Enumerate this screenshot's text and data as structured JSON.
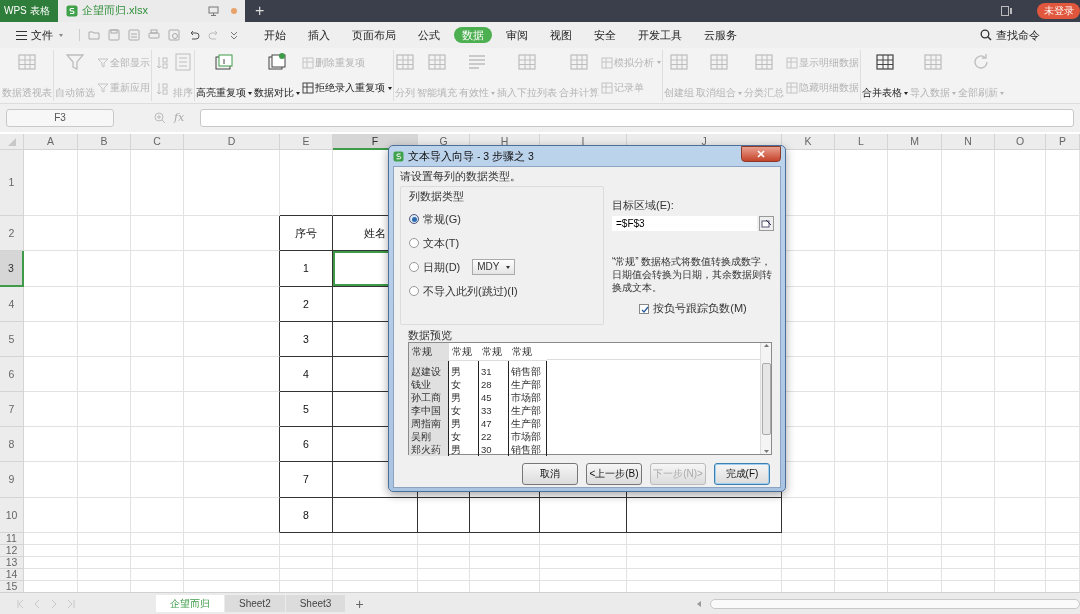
{
  "title_bar": {
    "app_tab": "WPS 表格",
    "file_tab": {
      "label": "企望而归.xlsx",
      "unsaved": true
    },
    "new_tab": "+",
    "account_badge": "未登录"
  },
  "menu_bar": {
    "file_menu": "文件",
    "tabs": [
      {
        "label": "开始",
        "selected": false
      },
      {
        "label": "插入",
        "selected": false
      },
      {
        "label": "页面布局",
        "selected": false
      },
      {
        "label": "公式",
        "selected": false
      },
      {
        "label": "数据",
        "selected": true
      },
      {
        "label": "审阅",
        "selected": false
      },
      {
        "label": "视图",
        "selected": false
      },
      {
        "label": "安全",
        "selected": false
      },
      {
        "label": "开发工具",
        "selected": false
      },
      {
        "label": "云服务",
        "selected": false
      }
    ],
    "search": "查找命令"
  },
  "ribbon": {
    "groups": [
      {
        "items": [
          {
            "kind": "large",
            "label": "数据透视表",
            "disabled": true,
            "dropdown": false
          }
        ]
      },
      {
        "items": [
          {
            "kind": "large",
            "label": "自动筛选",
            "disabled": true,
            "dropdown": false
          },
          {
            "kind": "stack",
            "items": [
              {
                "label": "全部显示",
                "disabled": true,
                "dropdown": false
              },
              {
                "label": "重新应用",
                "disabled": true,
                "dropdown": false
              }
            ]
          }
        ]
      },
      {
        "items": [
          {
            "kind": "icon-stack",
            "items": [
              {
                "disabled": true
              },
              {
                "disabled": true
              }
            ]
          },
          {
            "kind": "large",
            "label": "排序",
            "disabled": true,
            "dropdown": false
          }
        ]
      },
      {
        "items": [
          {
            "kind": "large",
            "label": "高亮重复项",
            "disabled": false,
            "dropdown": true
          },
          {
            "kind": "large",
            "label": "数据对比",
            "disabled": false,
            "dropdown": true
          },
          {
            "kind": "stack",
            "items": [
              {
                "label": "删除重复项",
                "disabled": true,
                "dropdown": false
              },
              {
                "label": "拒绝录入重复项",
                "disabled": false,
                "dropdown": true
              }
            ]
          }
        ]
      },
      {
        "items": [
          {
            "kind": "large",
            "label": "分列",
            "disabled": true,
            "dropdown": false
          },
          {
            "kind": "large",
            "label": "智能填充",
            "disabled": true,
            "dropdown": false
          },
          {
            "kind": "large",
            "label": "有效性",
            "disabled": true,
            "dropdown": true
          },
          {
            "kind": "large",
            "label": "插入下拉列表",
            "disabled": true,
            "dropdown": false
          },
          {
            "kind": "large",
            "label": "合并计算",
            "disabled": true,
            "dropdown": false
          },
          {
            "kind": "stack",
            "items": [
              {
                "label": "模拟分析",
                "disabled": true,
                "dropdown": true
              },
              {
                "label": "记录单",
                "disabled": true,
                "dropdown": false
              }
            ]
          }
        ]
      },
      {
        "items": [
          {
            "kind": "large",
            "label": "创建组",
            "disabled": true,
            "dropdown": false
          },
          {
            "kind": "large",
            "label": "取消组合",
            "disabled": true,
            "dropdown": true
          },
          {
            "kind": "large",
            "label": "分类汇总",
            "disabled": true,
            "dropdown": false
          },
          {
            "kind": "stack",
            "items": [
              {
                "label": "显示明细数据",
                "disabled": true,
                "dropdown": false
              },
              {
                "label": "隐藏明细数据",
                "disabled": true,
                "dropdown": false
              }
            ]
          }
        ]
      },
      {
        "items": [
          {
            "kind": "large",
            "label": "合并表格",
            "disabled": false,
            "dropdown": true
          },
          {
            "kind": "large",
            "label": "导入数据",
            "disabled": true,
            "dropdown": true
          },
          {
            "kind": "large",
            "label": "全部刷新",
            "disabled": true,
            "dropdown": true
          }
        ]
      }
    ]
  },
  "formula_bar": {
    "name_box": "F3",
    "function_label": "fx"
  },
  "sheet": {
    "columns": [
      {
        "label": "A",
        "selected": false
      },
      {
        "label": "B",
        "selected": false
      },
      {
        "label": "C",
        "selected": false
      },
      {
        "label": "D",
        "selected": false
      },
      {
        "label": "E",
        "selected": false
      },
      {
        "label": "F",
        "selected": true
      },
      {
        "label": "G",
        "selected": false
      },
      {
        "label": "H",
        "selected": false
      },
      {
        "label": "I",
        "selected": false
      },
      {
        "label": "J",
        "selected": false
      },
      {
        "label": "K",
        "selected": false
      },
      {
        "label": "L",
        "selected": false
      },
      {
        "label": "M",
        "selected": false
      },
      {
        "label": "N",
        "selected": false
      },
      {
        "label": "O",
        "selected": false
      },
      {
        "label": "P",
        "selected": false
      }
    ],
    "rows": [
      {
        "label": "1",
        "selected": false,
        "cells": []
      },
      {
        "label": "2",
        "selected": false,
        "cells": [
          {
            "text": "",
            "selected": false
          },
          {
            "text": "",
            "selected": false
          },
          {
            "text": "",
            "selected": false
          },
          {
            "text": "",
            "selected": false
          },
          {
            "text": "序号",
            "selected": false
          },
          {
            "text": "姓名",
            "selected": false
          }
        ]
      },
      {
        "label": "3",
        "selected": true,
        "cells": [
          {
            "text": "",
            "selected": false
          },
          {
            "text": "",
            "selected": false
          },
          {
            "text": "",
            "selected": false
          },
          {
            "text": "",
            "selected": false
          },
          {
            "text": "1",
            "selected": false
          },
          {
            "text": "",
            "selected": true
          }
        ]
      },
      {
        "label": "4",
        "selected": false,
        "cells": [
          {
            "text": "",
            "selected": false
          },
          {
            "text": "",
            "selected": false
          },
          {
            "text": "",
            "selected": false
          },
          {
            "text": "",
            "selected": false
          },
          {
            "text": "2",
            "selected": false
          }
        ]
      },
      {
        "label": "5",
        "selected": false,
        "cells": [
          {
            "text": "",
            "selected": false
          },
          {
            "text": "",
            "selected": false
          },
          {
            "text": "",
            "selected": false
          },
          {
            "text": "",
            "selected": false
          },
          {
            "text": "3",
            "selected": false
          }
        ]
      },
      {
        "label": "6",
        "selected": false,
        "cells": [
          {
            "text": "",
            "selected": false
          },
          {
            "text": "",
            "selected": false
          },
          {
            "text": "",
            "selected": false
          },
          {
            "text": "",
            "selected": false
          },
          {
            "text": "4",
            "selected": false
          }
        ]
      },
      {
        "label": "7",
        "selected": false,
        "cells": [
          {
            "text": "",
            "selected": false
          },
          {
            "text": "",
            "selected": false
          },
          {
            "text": "",
            "selected": false
          },
          {
            "text": "",
            "selected": false
          },
          {
            "text": "5",
            "selected": false
          }
        ]
      },
      {
        "label": "8",
        "selected": false,
        "cells": [
          {
            "text": "",
            "selected": false
          },
          {
            "text": "",
            "selected": false
          },
          {
            "text": "",
            "selected": false
          },
          {
            "text": "",
            "selected": false
          },
          {
            "text": "6",
            "selected": false
          }
        ]
      },
      {
        "label": "9",
        "selected": false,
        "cells": [
          {
            "text": "",
            "selected": false
          },
          {
            "text": "",
            "selected": false
          },
          {
            "text": "",
            "selected": false
          },
          {
            "text": "",
            "selected": false
          },
          {
            "text": "7",
            "selected": false
          }
        ]
      },
      {
        "label": "10",
        "selected": false,
        "cells": [
          {
            "text": "",
            "selected": false
          },
          {
            "text": "",
            "selected": false
          },
          {
            "text": "",
            "selected": false
          },
          {
            "text": "",
            "selected": false
          },
          {
            "text": "8",
            "selected": false
          }
        ]
      },
      {
        "label": "11",
        "selected": false,
        "cells": []
      },
      {
        "label": "12",
        "selected": false,
        "cells": []
      },
      {
        "label": "13",
        "selected": false,
        "cells": []
      },
      {
        "label": "14",
        "selected": false,
        "cells": []
      },
      {
        "label": "15",
        "selected": false,
        "cells": []
      }
    ]
  },
  "dialog": {
    "title": "文本导入向导 - 3 步骤之 3",
    "instruction": "请设置每列的数据类型。",
    "column_type": {
      "legend": "列数据类型",
      "options": [
        {
          "label": "常规(G)",
          "selected": true
        },
        {
          "label": "文本(T)",
          "selected": false
        },
        {
          "label": "日期(D)",
          "selected": false,
          "date_format": "MDY"
        },
        {
          "label": "不导入此列(跳过)(I)",
          "selected": false
        }
      ]
    },
    "destination": {
      "label": "目标区域(E):",
      "value": "=$F$3"
    },
    "note": "“常规” 数据格式将数值转换成数字，日期值会转换为日期，其余数据则转换成文本。",
    "negative_option": {
      "label": "按负号跟踪负数(M)",
      "checked": true
    },
    "preview": {
      "label": "数据预览",
      "headers": [
        {
          "label": "常规",
          "selected": true
        },
        {
          "label": "常规",
          "selected": false
        },
        {
          "label": "常规",
          "selected": false
        },
        {
          "label": "常规",
          "selected": false
        }
      ],
      "rows": [
        [
          "赵建设",
          "男",
          "31",
          "销售部"
        ],
        [
          "钱业",
          "女",
          "28",
          "生产部"
        ],
        [
          "孙工商",
          "男",
          "45",
          "市场部"
        ],
        [
          "李中国",
          "女",
          "33",
          "生产部"
        ],
        [
          "周指南",
          "男",
          "47",
          "生产部"
        ],
        [
          "吴刚",
          "女",
          "22",
          "市场部"
        ],
        [
          "郑火药",
          "男",
          "30",
          "销售部"
        ]
      ]
    },
    "buttons": [
      {
        "label": "取消",
        "disabled": false,
        "default": false
      },
      {
        "label": "<上一步(B)",
        "disabled": false,
        "default": false
      },
      {
        "label": "下一步(N)>",
        "disabled": true,
        "default": false
      },
      {
        "label": "完成(F)",
        "disabled": false,
        "default": true
      }
    ]
  },
  "sheet_tabs": [
    {
      "label": "企望而归",
      "selected": true
    },
    {
      "label": "Sheet2",
      "selected": false
    },
    {
      "label": "Sheet3",
      "selected": false
    }
  ],
  "add_sheet": "+"
}
